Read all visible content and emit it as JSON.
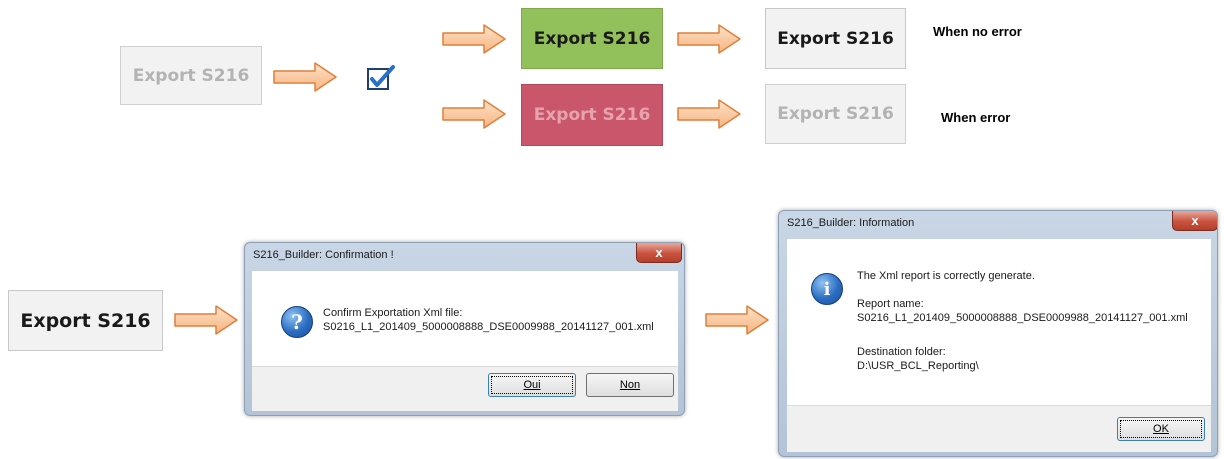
{
  "buttons": {
    "export_label": "Export S216"
  },
  "notes": {
    "no_error": "When no error",
    "error": "When error"
  },
  "confirm_dialog": {
    "title": "S216_Builder: Confirmation !",
    "message_line1": "Confirm Exportation Xml file:",
    "message_line2": "S0216_L1_201409_5000008888_DSE0009988_20141127_001.xml",
    "yes_label": "Oui",
    "no_label": "Non",
    "close_label": "x"
  },
  "info_dialog": {
    "title": "S216_Builder: Information",
    "line1": "The Xml report is correctly generate.",
    "line2": "Report name:",
    "line3": "S0216_L1_201409_5000008888_DSE0009988_20141127_001.xml",
    "line4": "Destination folder:",
    "line5": "D:\\USR_BCL_Reporting\\",
    "ok_label": "OK",
    "close_label": "x"
  },
  "colors": {
    "arrow_fill": "#f9c296",
    "arrow_stroke": "#e07f3a",
    "green_button": "#92c05a",
    "red_button": "#c9566b"
  },
  "icons": [
    "arrow-right-icon",
    "checkbox-checked-icon",
    "question-icon",
    "info-icon"
  ]
}
